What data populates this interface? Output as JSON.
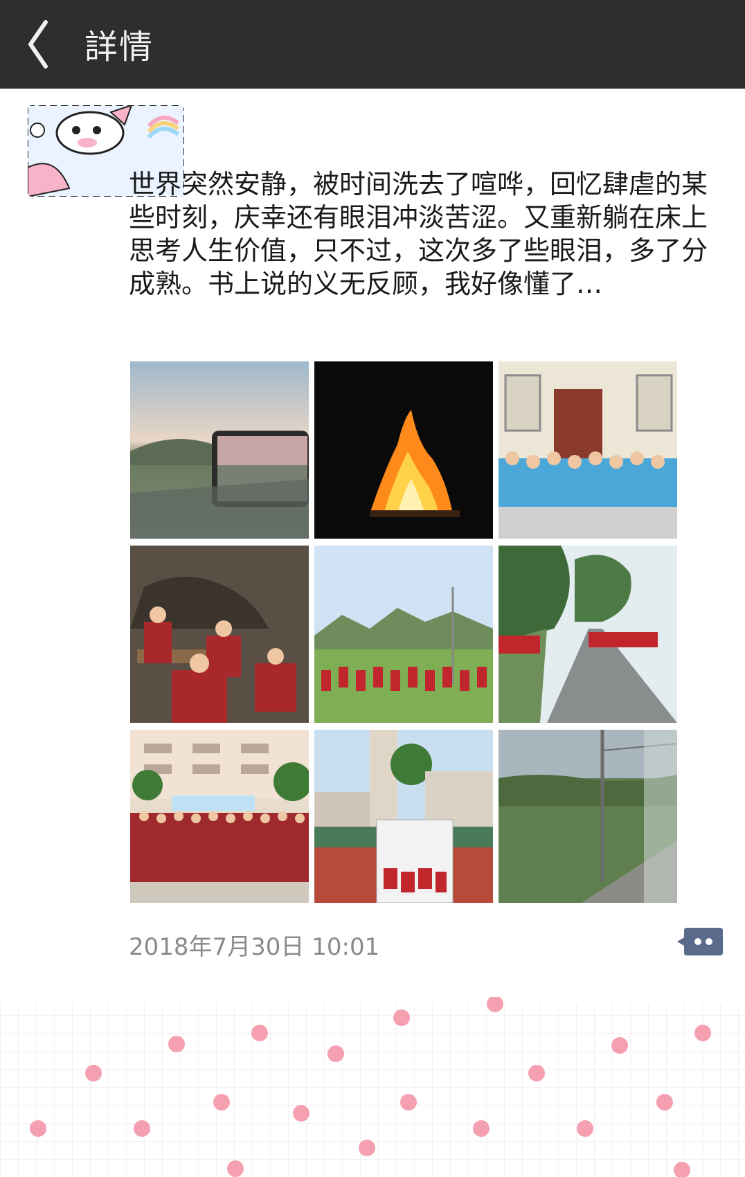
{
  "header": {
    "title": "詳情",
    "background": "#2e2e2e"
  },
  "post": {
    "text": "世界突然安静，被时间洗去了喧哗，回忆肆虐的某些时刻，庆幸还有眼泪冲淡苦涩。又重新躺在床上思考人生价值，只不过，这次多了些眼泪，多了分成熟。书上说的义无反顾，我好像懂了…",
    "photos": [
      {
        "icon": "car-window-sunset-photo"
      },
      {
        "icon": "bonfire-night-photo"
      },
      {
        "icon": "group-sitting-by-door-photo"
      },
      {
        "icon": "people-in-room-photo"
      },
      {
        "icon": "group-in-field-photo"
      },
      {
        "icon": "group-on-road-photo"
      },
      {
        "icon": "large-group-school-photo"
      },
      {
        "icon": "school-yard-photo"
      },
      {
        "icon": "train-window-landscape-photo"
      }
    ],
    "timestamp": "2018年7月30日 10:01"
  },
  "colors": {
    "comment_button": "#5a6a8a",
    "timestamp": "#8a8a8a"
  }
}
